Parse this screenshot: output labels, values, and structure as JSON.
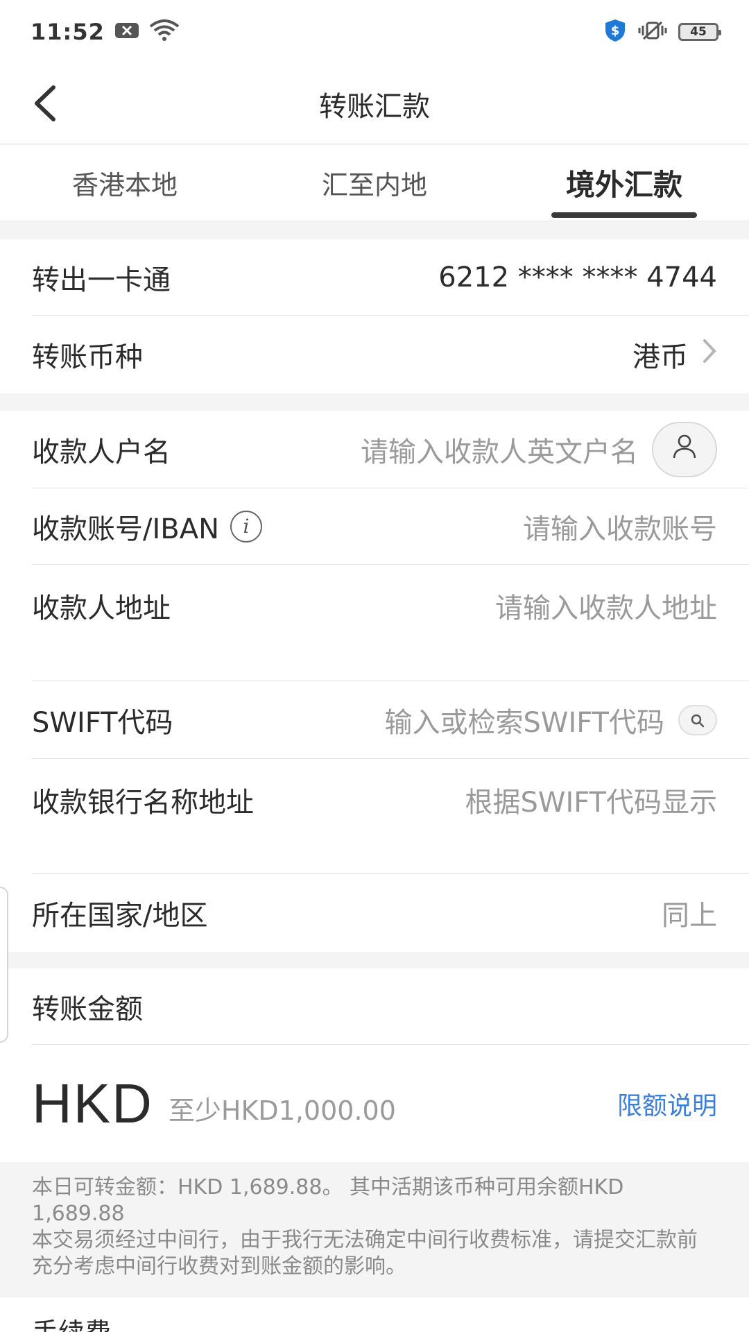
{
  "status_bar": {
    "time": "11:52",
    "battery": "45",
    "icons": [
      "notification-x-icon",
      "wifi-icon",
      "shield-dollar-icon",
      "vibrate-icon",
      "battery-icon"
    ]
  },
  "header": {
    "title": "转账汇款"
  },
  "tabs": [
    {
      "label": "香港本地",
      "active": false
    },
    {
      "label": "汇至内地",
      "active": false
    },
    {
      "label": "境外汇款",
      "active": true
    }
  ],
  "account_section": {
    "out_card_label": "转出一卡通",
    "out_card_value": "6212 **** **** 4744",
    "currency_label": "转账币种",
    "currency_value": "港币"
  },
  "payee_section": {
    "name_label": "收款人户名",
    "name_placeholder": "请输入收款人英文户名",
    "account_label": "收款账号/IBAN",
    "account_placeholder": "请输入收款账号",
    "address_label": "收款人地址",
    "address_placeholder": "请输入收款人地址",
    "swift_label": "SWIFT代码",
    "swift_placeholder": "输入或检索SWIFT代码",
    "bank_label": "收款银行名称地址",
    "bank_placeholder": "根据SWIFT代码显示",
    "country_label": "所在国家/地区",
    "country_value": "同上"
  },
  "amount_section": {
    "label": "转账金额",
    "currency": "HKD",
    "hint": "至少HKD1,000.00",
    "limit_link": "限额说明"
  },
  "notice": {
    "line1": "本日可转金额：HKD 1,689.88。 其中活期该币种可用余额HKD 1,689.88",
    "line2": "本交易须经过中间行，由于我行无法确定中间行收费标准，请提交汇款前充分考虑中间行收费对到账金额的影响。"
  },
  "fee_section": {
    "label": "手续费"
  },
  "colors": {
    "accent_link": "#3d7fd8",
    "placeholder": "#9a9a9a",
    "text": "#2b2b2b",
    "page_bg": "#f4f4f5"
  }
}
